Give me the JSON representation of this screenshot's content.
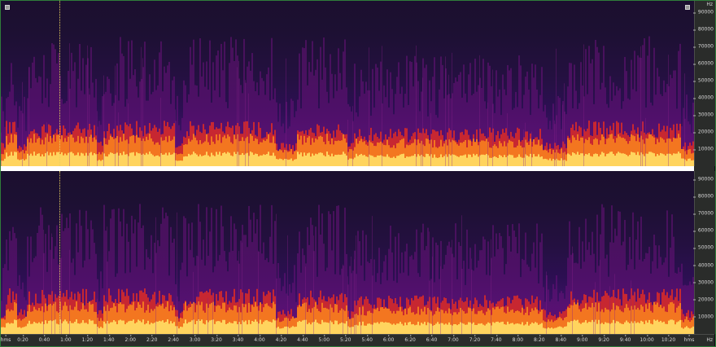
{
  "app": {
    "view": "spectral-frequency-display"
  },
  "colors": {
    "frame_border": "#2f7d3a",
    "spectrogram_low": "#1b0f2e",
    "spectrogram_mid": "#5a106e",
    "spectrogram_hot": "#e8301a",
    "spectrogram_peak": "#ffe070",
    "playhead": "#e8d060",
    "ruler_bg": "#2a2c2a",
    "ruler_text": "#d8d8d8"
  },
  "icons": {
    "top_left": "view-toggle-icon",
    "top_right": "view-toggle-icon"
  },
  "yaxis": {
    "unit": "Hz",
    "ticks": [
      "90000",
      "80000",
      "70000",
      "60000",
      "50000",
      "40000",
      "30000",
      "20000",
      "10000"
    ]
  },
  "xaxis": {
    "start_label": "hms",
    "end_label": "hms",
    "ticks": [
      "0:20",
      "0:40",
      "1:00",
      "1:20",
      "1:40",
      "2:00",
      "2:20",
      "2:40",
      "3:00",
      "3:20",
      "3:40",
      "4:00",
      "4:20",
      "4:40",
      "5:00",
      "5:20",
      "5:40",
      "6:00",
      "6:20",
      "6:40",
      "7:00",
      "7:20",
      "7:40",
      "8:00",
      "8:20",
      "8:40",
      "9:00",
      "9:20",
      "9:40",
      "10:00",
      "10:20"
    ]
  },
  "channels": [
    "top",
    "bottom"
  ],
  "playhead_time": "0:58"
}
